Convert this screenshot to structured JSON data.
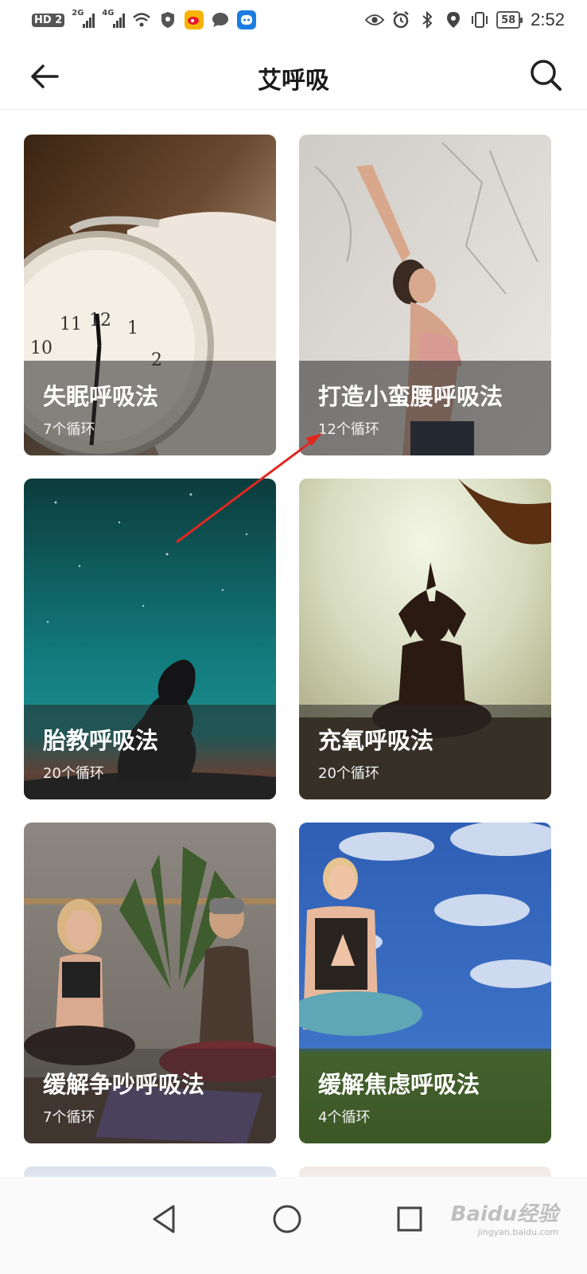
{
  "status_bar": {
    "hd_badge": "HD 2",
    "net1_label": "2G",
    "net2_label": "4G",
    "battery": "58",
    "time": "2:52"
  },
  "header": {
    "title": "艾呼吸"
  },
  "cards": [
    {
      "title": "失眠呼吸法",
      "cycles": "7个循环"
    },
    {
      "title": "打造小蛮腰呼吸法",
      "cycles": "12个循环"
    },
    {
      "title": "胎教呼吸法",
      "cycles": "20个循环"
    },
    {
      "title": "充氧呼吸法",
      "cycles": "20个循环"
    },
    {
      "title": "缓解争吵呼吸法",
      "cycles": "7个循环"
    },
    {
      "title": "缓解焦虑呼吸法",
      "cycles": "4个循环"
    }
  ],
  "watermark": {
    "brand": "Baidu经验",
    "site": "jingyan.baidu.com"
  },
  "colors": {
    "annotation_arrow": "#e0281f",
    "caption_overlay": "#282828"
  }
}
